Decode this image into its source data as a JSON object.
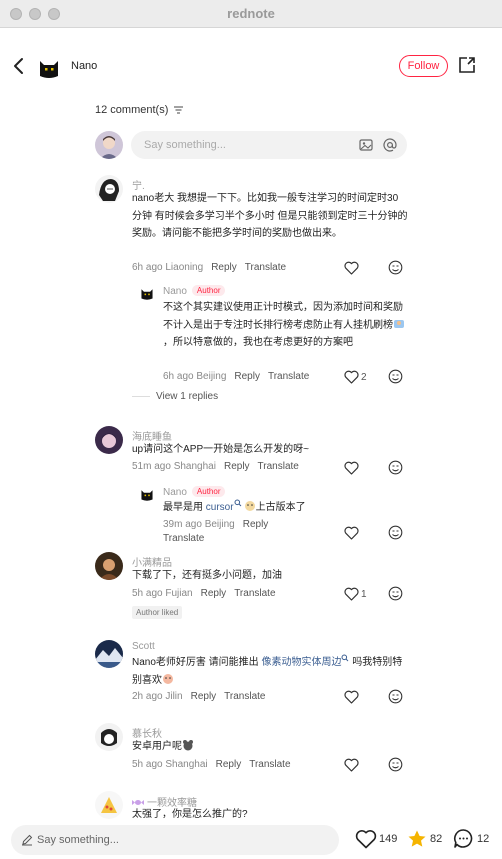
{
  "app": {
    "title": "rednote"
  },
  "header": {
    "author_name": "Nano",
    "follow_label": "Follow"
  },
  "comments_header": {
    "count_label": "12 comment(s)"
  },
  "composer": {
    "placeholder": "Say something..."
  },
  "actions": {
    "reply": "Reply",
    "translate": "Translate"
  },
  "comments": [
    {
      "user": "宁.",
      "text": "nano老大 我想提一下下。比如我一般专注学习的时间定时30分钟 有时候会多学习半个多小时 但是只能领到定时三十分钟的奖励。请问能不能把多学时间的奖励也做出来。",
      "time_location": "6h ago Liaoning"
    },
    {
      "user": "Nano",
      "badge": "Author",
      "text": "不这个其实建议使用正计时模式，因为添加时间和奖励不计入是出于专注时长排行榜考虑防止有人挂机刷榜",
      "text2": "，所以特意做的，我也在考虑更好的方案吧",
      "time_location": "6h ago Beijing",
      "likes": "2"
    },
    {
      "view_replies": "View 1 replies"
    },
    {
      "user": "海底睡鱼",
      "text": "up请问这个APP一开始是怎么开发的呀~",
      "time_location": "51m ago Shanghai"
    },
    {
      "user": "Nano",
      "badge": "Author",
      "text_pre": "最早是用 ",
      "link": "cursor",
      "text_post": "上古版本了",
      "time_location": "39m ago Beijing"
    },
    {
      "user": "小满精品",
      "text": "下载了下，还有挺多小问题，加油",
      "time_location": "5h ago Fujian",
      "likes": "1",
      "tag": "Author liked"
    },
    {
      "user": "Scott",
      "text_pre": "Nano老师好厉害 请问能推出 ",
      "link": "像素动物实体周边",
      "text_post": " 吗我特别特别喜欢",
      "time_location": "2h ago Jilin"
    },
    {
      "user": "慕长秋",
      "text": "安卓用户呢",
      "time_location": "5h ago Shanghai"
    },
    {
      "user": "一颗效率糖",
      "text": "太强了，你是怎么推广的?"
    }
  ],
  "bottom_bar": {
    "placeholder": "Say something...",
    "likes": "149",
    "collects": "82",
    "comments": "12"
  },
  "colors": {
    "accent": "#ff2442",
    "star": "#f5b400",
    "link": "#3b5e91"
  }
}
